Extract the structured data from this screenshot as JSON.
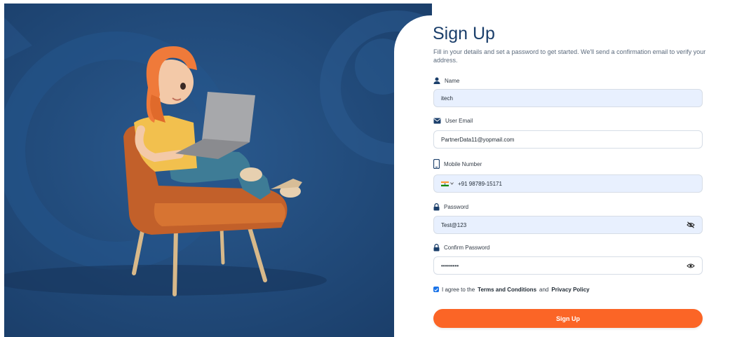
{
  "form": {
    "title": "Sign Up",
    "subtitle": "Fill in your details and set a password to get started. We'll send a confirmation email to verify your address.",
    "fields": {
      "name": {
        "label": "Name",
        "value": "itech",
        "icon": "user-icon"
      },
      "email": {
        "label": "User Email",
        "value": "PartnerData11@yopmail.com",
        "icon": "envelope-icon"
      },
      "mobile": {
        "label": "Mobile Number",
        "value": "+91 98789-15171",
        "icon": "mobile-phone-icon",
        "country": "india-flag-icon"
      },
      "password": {
        "label": "Password",
        "value": "Test@123",
        "icon": "lock-icon",
        "toggle": "eye-slash-icon"
      },
      "confirm_password": {
        "label": "Confirm Password",
        "value": "•••••••••",
        "icon": "lock-icon",
        "toggle": "eye-icon"
      }
    },
    "terms": {
      "checked": true,
      "prefix": "I agree to the",
      "terms_link": "Terms and Conditions",
      "and": "and",
      "privacy_link": "Privacy Policy"
    },
    "submit_label": "Sign Up"
  },
  "colors": {
    "hero_bg": "#1e4677",
    "title": "#1b3f6b",
    "accent": "#fb6526",
    "input_fill": "#e8f0fe",
    "checkbox": "#1a73e8"
  }
}
